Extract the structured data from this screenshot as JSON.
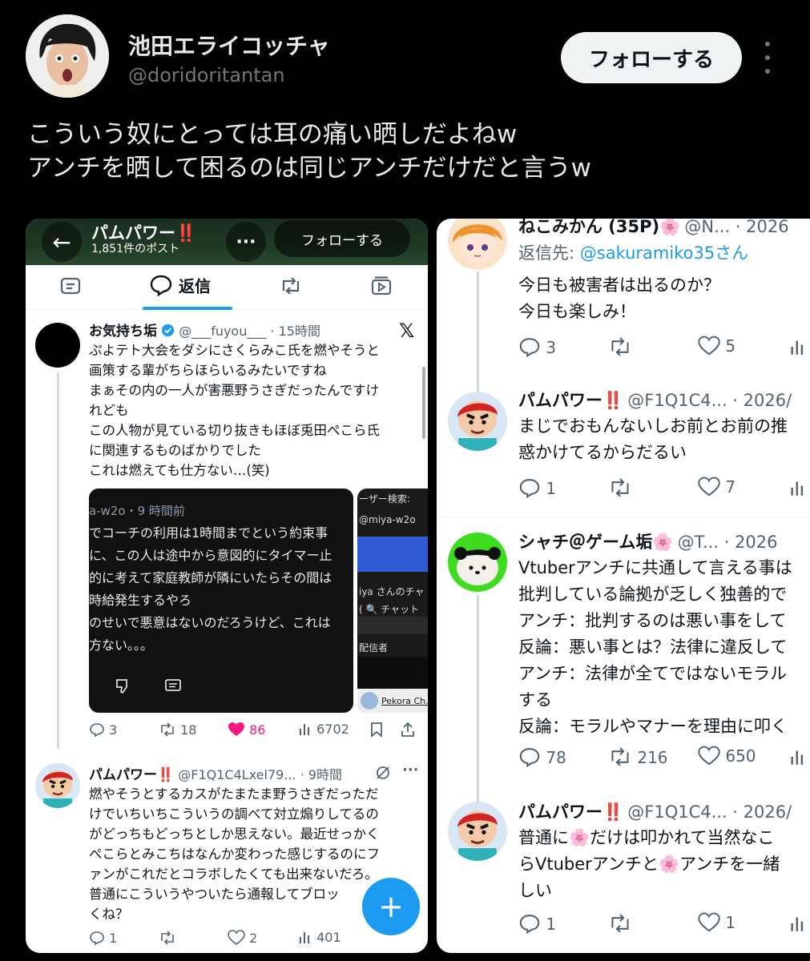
{
  "post": {
    "author_name": "池田エライコッチャ",
    "author_handle": "@doridoritantan",
    "follow_label": "フォローする",
    "text_lines": [
      "こういう奴にとっては耳の痛い晒しだよねw",
      "アンチを晒して困るのは同じアンチだけだと言うw"
    ]
  },
  "left_shot": {
    "header": {
      "title": "パムパワー‼️",
      "count": "1,851件のポスト",
      "follow_label": "フォローする"
    },
    "tabs": {
      "reply_label": "返信"
    },
    "tweet1": {
      "name": "お気持ち垢",
      "handle": "@___fuyou___",
      "time": "· 15時間",
      "lines": [
        "ぷよテト大会をダシにさくらみこ氏を燃やそうと",
        "画策する輩がちらほらいるみたいですね",
        "まぁその内の一人が害悪野うさぎだったんですけ",
        "れども",
        "この人物が見ている切り抜きもほぼ兎田ぺこら氏",
        "に関連するものばかりでした",
        "これは燃えても仕方ない…(笑)"
      ],
      "media_lines": [
        "a-w2o・9 時間前",
        "でコーチの利用は1時間までという約束事",
        "に、この人は途中から意図的にタイマー止",
        "",
        "的に考えて家庭教師が隣にいたらその間は",
        "時給発生するやろ",
        "のせいで悪意はないのだろうけど、これは",
        "方ない。。。"
      ],
      "media2_lines": [
        "ーザー検索:",
        "@miya-w2o",
        "iya さんのチャ",
        "( 🔍 チャット",
        "配信者",
        "Pekora Ch. !"
      ],
      "stats": {
        "replies": "3",
        "retweets": "18",
        "likes": "86",
        "views": "6702"
      }
    },
    "tweet2": {
      "name": "パムパワー‼️",
      "handle": "@F1Q1C4Lxel79...",
      "time": "· 9時間",
      "lines": [
        "燃やそうとするカスがたまたま野うさぎだっただ",
        "けでいちいちこういうの調べて対立煽りしてるの",
        "がどっちもどっちとしか思えない。最近せっかく",
        "ぺこらとみこちはなんか変わった感じするのにフ",
        "ァンがこれだとコラボしたくても出来ないだろ。",
        "普通にこういうやついたら通報してブロッ",
        "くね？"
      ],
      "stats": {
        "replies": "1",
        "likes": "2",
        "views": "401"
      }
    }
  },
  "right_shot": {
    "posts": [
      {
        "name": "ねこみかん (35P)🌸",
        "handle": "@N... · 2026",
        "reply_to_prefix": "返信先: ",
        "reply_to_user": "@sakuramiko35さん",
        "lines": [
          "今日も被害者は出るのか？",
          "今日も楽しみ！"
        ],
        "stats": {
          "replies": "3",
          "likes": "5"
        }
      },
      {
        "name": "パムパワー‼️",
        "handle": "@F1Q1C4... · 2026/",
        "lines": [
          "まじでおもんないしお前とお前の推",
          "惑かけてるからだるい"
        ],
        "stats": {
          "replies": "1",
          "likes": "7"
        }
      },
      {
        "name": "シャチ＠ゲーム垢🌸",
        "handle": "@T... · 2026",
        "lines": [
          "Vtuberアンチに共通して言える事は",
          "批判している論拠が乏しく独善的で",
          "アンチ：批判するのは悪い事をして",
          "反論：悪い事とは？法律に違反して",
          "アンチ：法律が全てではないモラル",
          "する",
          "反論：モラルやマナーを理由に叩く"
        ],
        "stats": {
          "replies": "78",
          "retweets": "216",
          "likes": "650"
        }
      },
      {
        "name": "パムパワー‼️",
        "handle": "@F1Q1C4... · 2026/",
        "lines": [
          "普通に🌸だけは叩かれて当然なこ",
          "らVtuberアンチと🌸アンチを一緒",
          "しい"
        ],
        "stats": {
          "replies": "1",
          "likes": "1"
        }
      }
    ]
  },
  "colors": {
    "like_pink": "#f91880",
    "link_blue": "#1d9bf0",
    "muted": "#536471"
  }
}
